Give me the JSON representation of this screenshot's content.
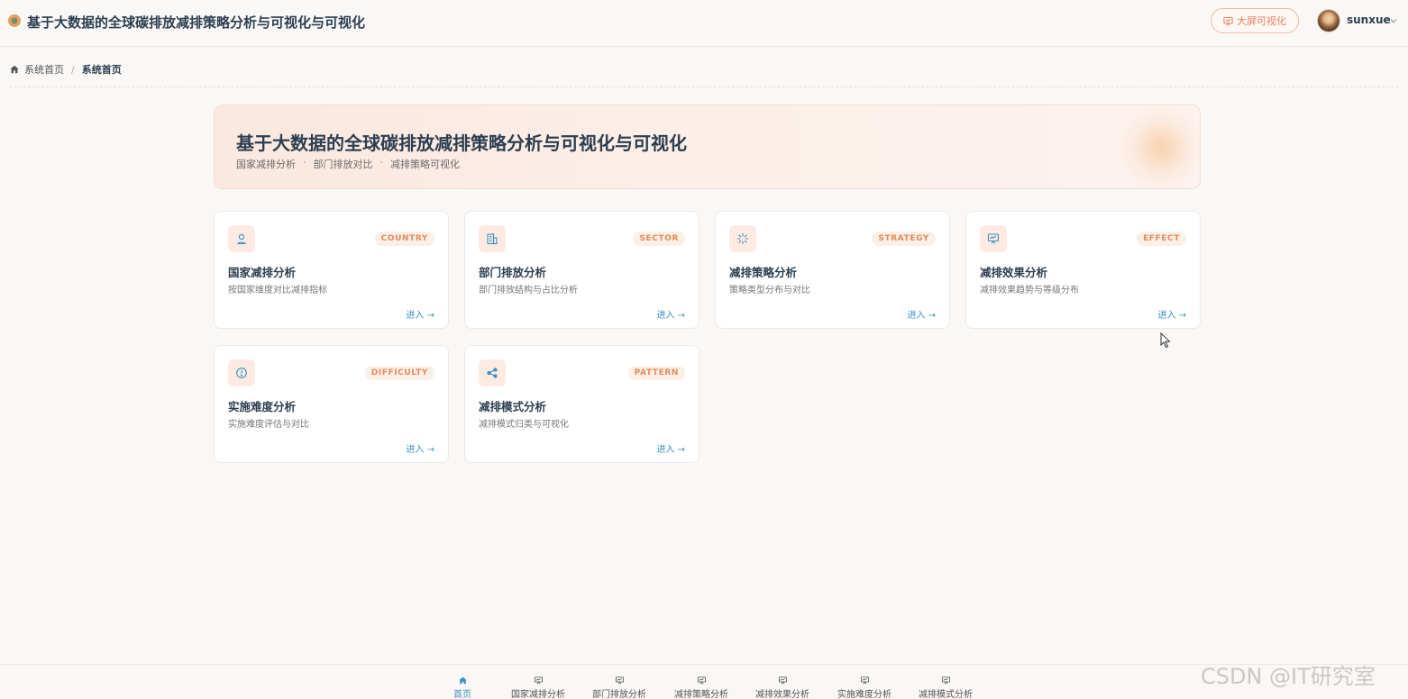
{
  "header": {
    "title": "基于大数据的全球碳排放减排策略分析与可视化与可视化",
    "big_screen_label": "大屏可视化",
    "username": "sunxue"
  },
  "breadcrumb": {
    "home": "系统首页",
    "separator": "/",
    "current": "系统首页"
  },
  "banner": {
    "title": "基于大数据的全球碳排放减排策略分析与可视化与可视化",
    "sub": [
      "国家减排分析",
      "部门排放对比",
      "减排策略可视化"
    ],
    "dot": "·"
  },
  "cards": [
    {
      "tag": "COUNTRY",
      "title": "国家减排分析",
      "desc": "按国家维度对比减排指标",
      "enter": "进入 →",
      "icon": "location-icon"
    },
    {
      "tag": "SECTOR",
      "title": "部门排放分析",
      "desc": "部门排放结构与占比分析",
      "enter": "进入 →",
      "icon": "building-icon"
    },
    {
      "tag": "STRATEGY",
      "title": "减排策略分析",
      "desc": "策略类型分布与对比",
      "enter": "进入 →",
      "icon": "loading-icon"
    },
    {
      "tag": "EFFECT",
      "title": "减排效果分析",
      "desc": "减排效果趋势与等级分布",
      "enter": "进入 →",
      "icon": "presentation-icon"
    },
    {
      "tag": "DIFFICULTY",
      "title": "实施难度分析",
      "desc": "实施难度评估与对比",
      "enter": "进入 →",
      "icon": "warning-icon"
    },
    {
      "tag": "PATTERN",
      "title": "减排模式分析",
      "desc": "减排模式归类与可视化",
      "enter": "进入 →",
      "icon": "share-icon"
    }
  ],
  "bottom_nav": [
    {
      "label": "首页",
      "icon": "home-icon",
      "active": true
    },
    {
      "label": "国家减排分析",
      "icon": "chart-board-icon"
    },
    {
      "label": "部门排放分析",
      "icon": "chart-board-icon"
    },
    {
      "label": "减排策略分析",
      "icon": "chart-board-icon"
    },
    {
      "label": "减排效果分析",
      "icon": "chart-board-icon"
    },
    {
      "label": "实施难度分析",
      "icon": "chart-board-icon"
    },
    {
      "label": "减排模式分析",
      "icon": "chart-board-icon"
    }
  ],
  "watermark": "CSDN @IT研究室",
  "colors": {
    "accent": "#e58363",
    "link": "#3a8fbf",
    "background": "#faf8f6"
  }
}
